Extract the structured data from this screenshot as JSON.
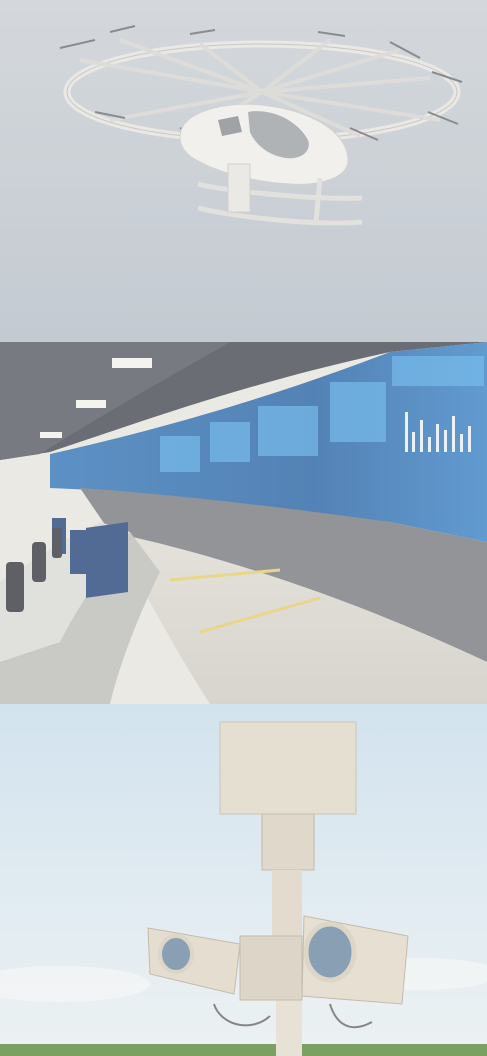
{
  "panels": [
    {
      "name": "evtol-aircraft-photo",
      "palette": {
        "sky_top": "#c9ced3",
        "sky_bottom": "#b9c1ca",
        "body": "#ecebe7",
        "frame": "#d9d8d4",
        "canopy": "#9fa3a6"
      }
    },
    {
      "name": "control-room-photo",
      "palette": {
        "ceiling": "#e5e3dd",
        "wall_screen": "#2f6db0",
        "screen_glow": "#56a7e6",
        "floor": "#d4d1c8",
        "desk": "#d8d8d5",
        "stripe": "#e0c66a",
        "monitor": "#2d4b7e"
      }
    },
    {
      "name": "surveillance-tower-photo",
      "palette": {
        "sky_top": "#cfe0ec",
        "sky_bottom": "#e6eef2",
        "device": "#ded5c4",
        "device_dark": "#b8ae9b",
        "lens": "#6f8aa3",
        "grass": "#5f8b3f"
      }
    }
  ]
}
